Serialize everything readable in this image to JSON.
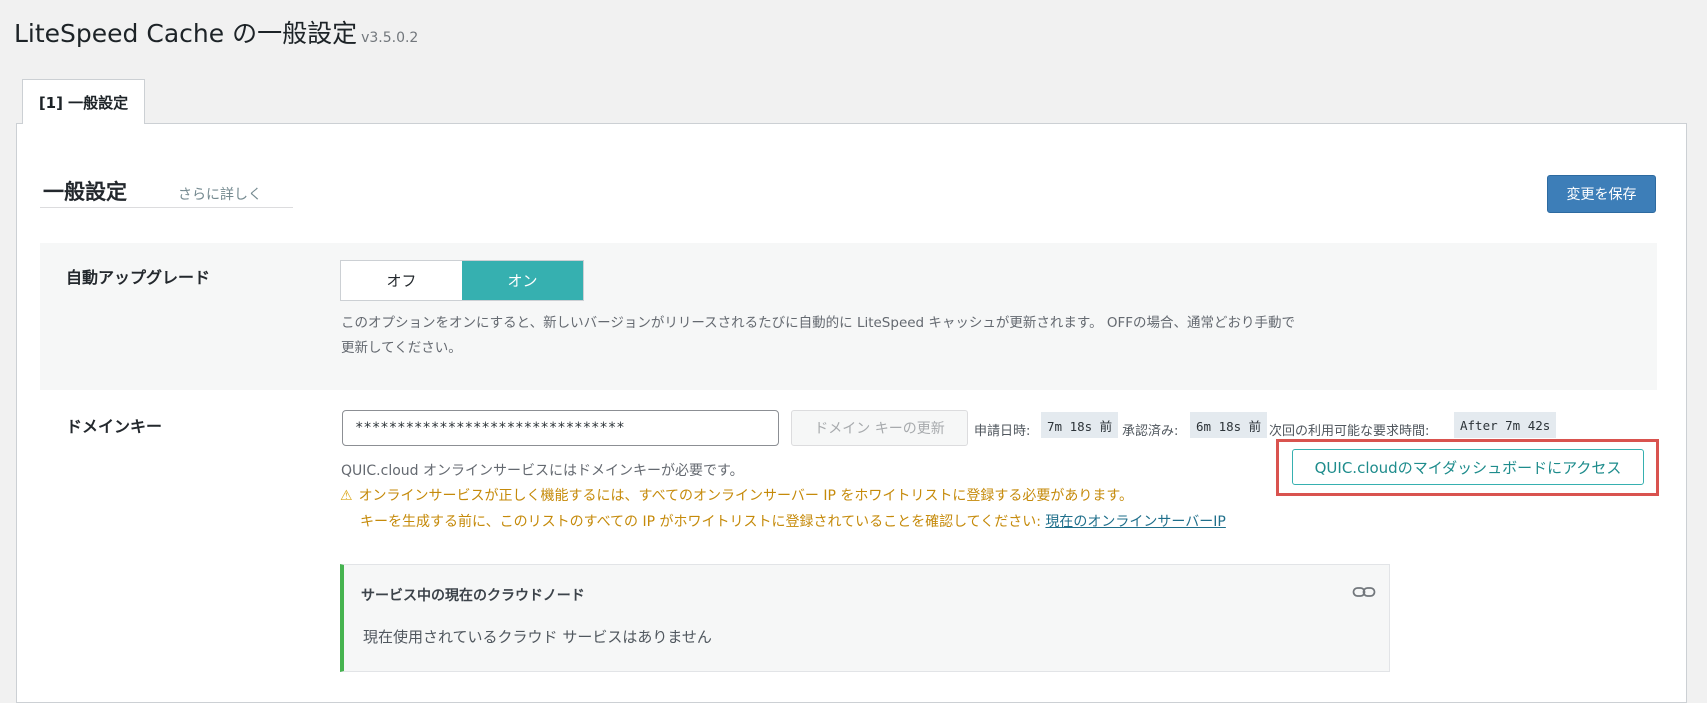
{
  "page": {
    "title": "LiteSpeed Cache の一般設定",
    "version": "v3.5.0.2"
  },
  "tabs": [
    {
      "label": "[1] 一般設定"
    }
  ],
  "section": {
    "title": "一般設定",
    "learn_more": "さらに詳しく",
    "save_label": "変更を保存"
  },
  "auto_upgrade": {
    "label": "自動アップグレード",
    "off_label": "オフ",
    "on_label": "オン",
    "selected": "オン",
    "desc_line1": "このオプションをオンにすると、新しいバージョンがリリースされるたびに自動的に LiteSpeed キャッシュが更新されます。 OFFの場合、通常どおり手動で",
    "desc_line2": "更新してください。"
  },
  "domain_key": {
    "label": "ドメインキー",
    "value": "********************************",
    "refresh_label": "ドメイン キーの更新",
    "applied_label": "申請日時:",
    "applied_value": "7m 18s 前",
    "approved_label": "承認済み:",
    "approved_value": "6m 18s 前",
    "next_label": "次回の利用可能な要求時間:",
    "next_value": "After 7m 42s",
    "dashboard_label": "QUIC.cloudのマイダッシュボードにアクセス",
    "info": "QUIC.cloud オンラインサービスにはドメインキーが必要です。",
    "warning_line1": "オンラインサービスが正しく機能するには、すべてのオンラインサーバー IP をホワイトリストに登録する必要があります。",
    "warning_line2": "キーを生成する前に、このリストのすべての IP がホワイトリストに登録されていることを確認してください:",
    "ip_link": "現在のオンラインサーバーIP"
  },
  "cloud_node": {
    "title": "サービス中の現在のクラウドノード",
    "body": "現在使用されているクラウド サービスはありません"
  },
  "colors": {
    "accent_teal": "#36b0b0",
    "save_blue": "#3d7eb8",
    "warning": "#c58a0a",
    "highlight_red": "#d9534f",
    "node_green": "#46b450"
  },
  "icons": {
    "warning": "warning-icon",
    "link": "link-icon"
  }
}
